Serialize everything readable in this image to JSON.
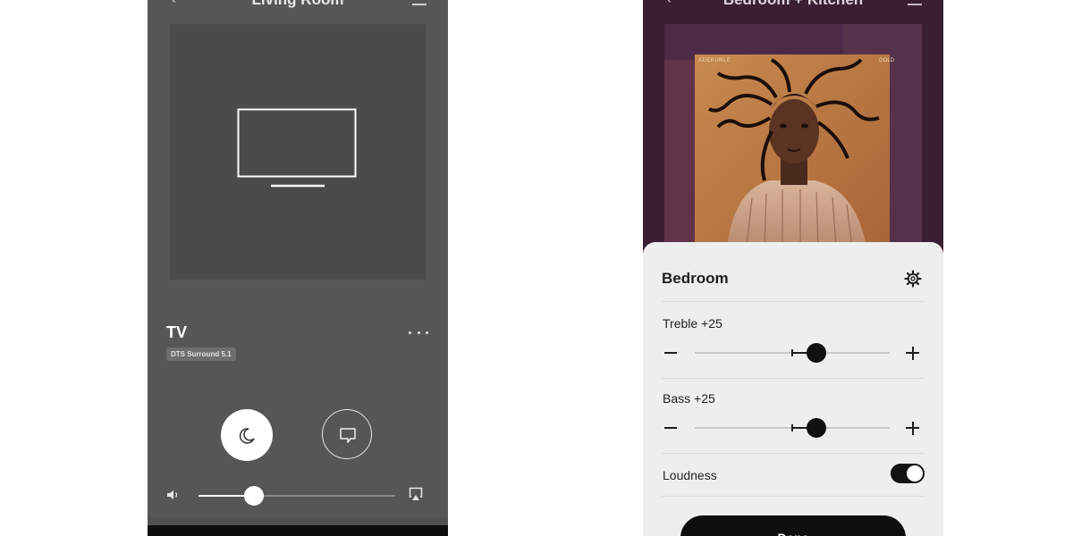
{
  "left_screen": {
    "room_title": "Living Room",
    "source": {
      "title": "TV",
      "audio_format_badge": "DTS Surround 5.1"
    },
    "volume_level": 0.28
  },
  "right_screen": {
    "room_title": "Bedroom + Kitchen",
    "album_cover_text": {
      "left": "ADEKUNLE",
      "right": "GOLD"
    },
    "settings_panel": {
      "title": "Bedroom",
      "treble": {
        "label": "Treble +25",
        "value": 25,
        "min": -100,
        "max": 100
      },
      "bass": {
        "label": "Bass +25",
        "value": 25,
        "min": -100,
        "max": 100
      },
      "loudness": {
        "label": "Loudness",
        "enabled": true
      },
      "done_label": "Done"
    }
  },
  "colors": {
    "left_background": "#565656",
    "right_background": "#3a1f33",
    "sheet_background": "#eeeeee",
    "accent_dark": "#111111"
  },
  "icons": {
    "tv": "tv-icon",
    "sleep": "moon-icon",
    "speech": "speech-bubble-icon",
    "volume": "speaker-icon",
    "airplay": "airplay-icon",
    "settings": "gear-icon",
    "more": "more-icon"
  }
}
